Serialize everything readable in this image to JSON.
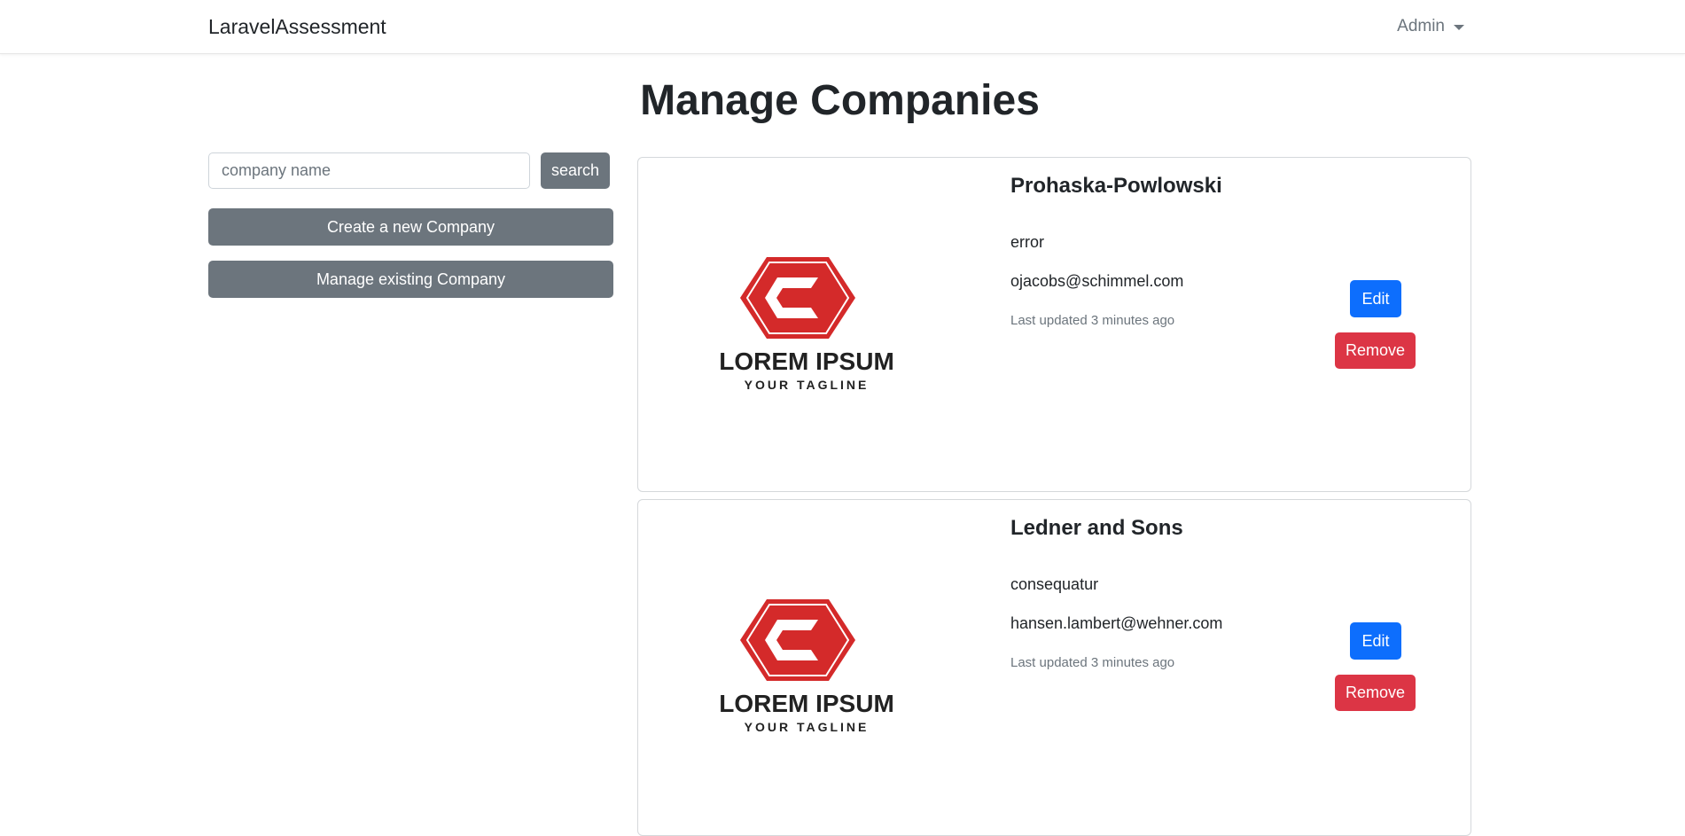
{
  "navbar": {
    "brand": "LaravelAssessment",
    "user_menu": "Admin"
  },
  "page": {
    "title": "Manage Companies"
  },
  "sidebar": {
    "search_placeholder": "company name",
    "search_value": "",
    "search_button": "search",
    "create_button": "Create a new Company",
    "manage_button": "Manage existing Company"
  },
  "companies": [
    {
      "name": "Prohaska-Powlowski",
      "description": "error",
      "email": "ojacobs@schimmel.com",
      "updated": "Last updated 3 minutes ago",
      "logo_title": "LOREM IPSUM",
      "logo_tagline": "YOUR TAGLINE",
      "edit_label": "Edit",
      "remove_label": "Remove"
    },
    {
      "name": "Ledner and Sons",
      "description": "consequatur",
      "email": "hansen.lambert@wehner.com",
      "updated": "Last updated 3 minutes ago",
      "logo_title": "LOREM IPSUM",
      "logo_tagline": "YOUR TAGLINE",
      "edit_label": "Edit",
      "remove_label": "Remove"
    }
  ],
  "colors": {
    "primary": "#0d6efd",
    "danger": "#dc3545",
    "secondary": "#6c757d",
    "logo_red": "#d42a2a"
  }
}
